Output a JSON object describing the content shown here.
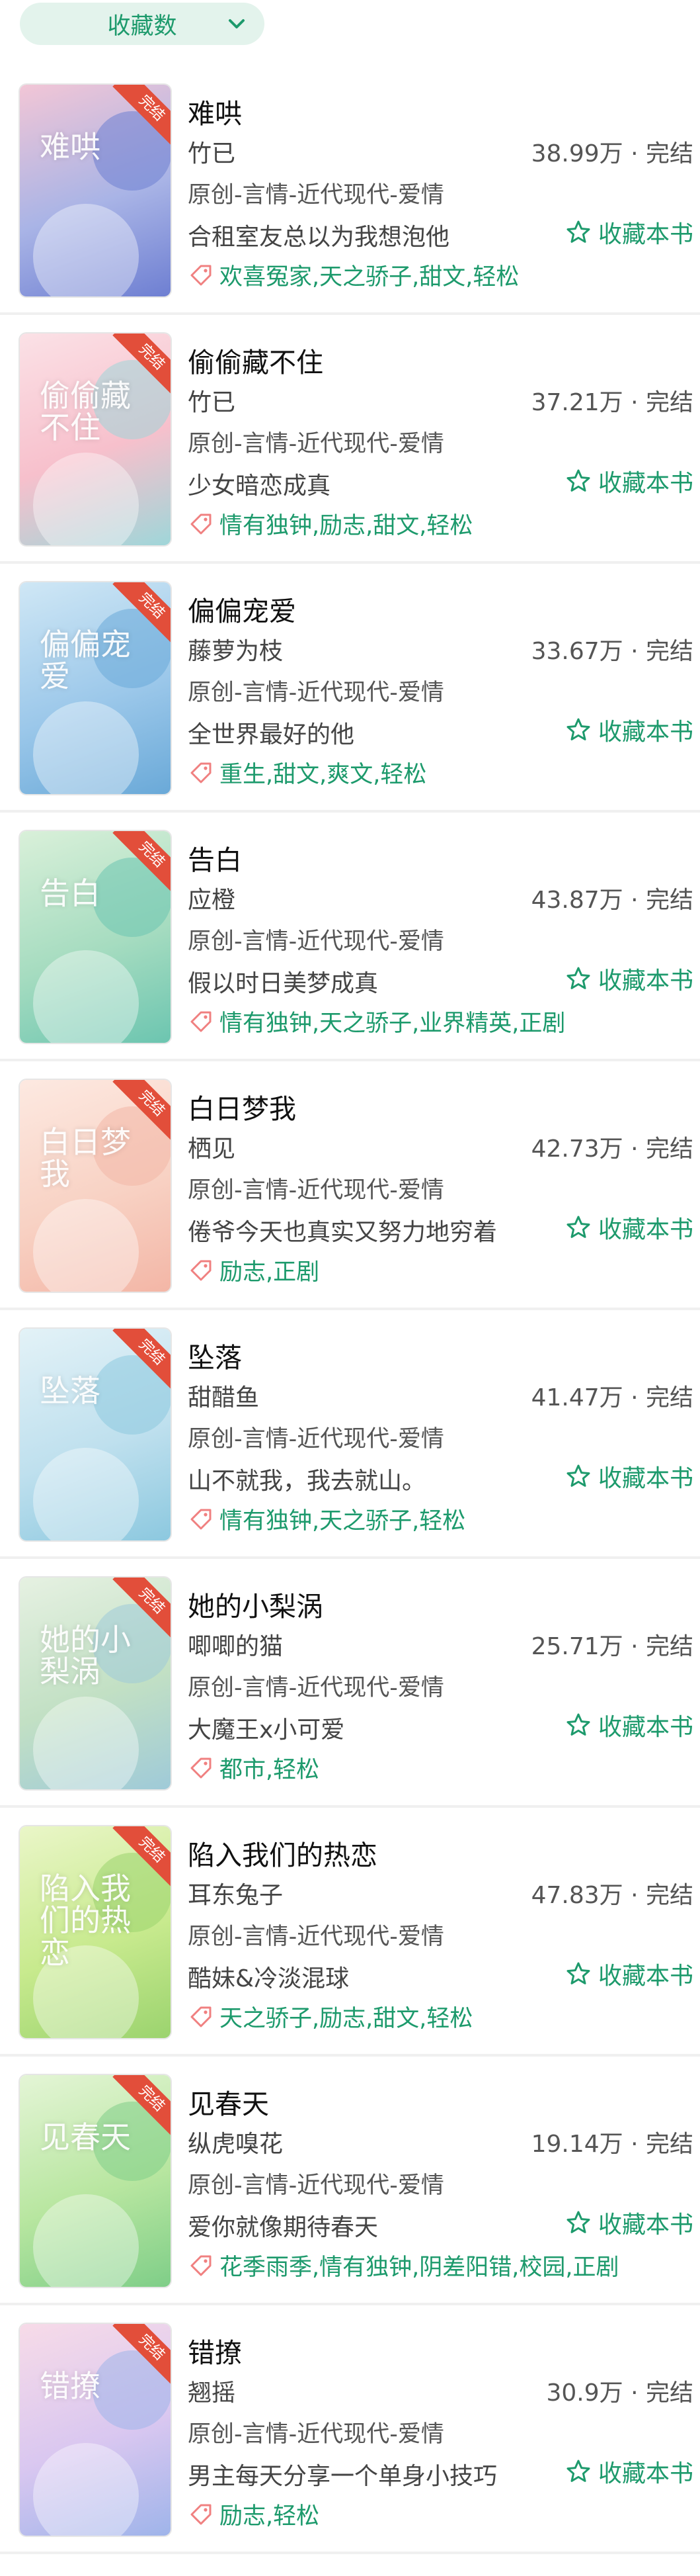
{
  "sort": {
    "label": "收藏数"
  },
  "collect_label": "收藏本书",
  "ribbon_text": "完结",
  "books": [
    {
      "title": "难哄",
      "author": "竹已",
      "stats": "38.99万 · 完结",
      "genre": "原创-言情-近代现代-爱情",
      "desc": "合租室友总以为我想泡他",
      "tags": "欢喜冤家,天之骄子,甜文,轻松",
      "cover_title": "难哄",
      "colors": [
        "#f2c6d6",
        "#a9b4e6",
        "#6e7fd2"
      ]
    },
    {
      "title": "偷偷藏不住",
      "author": "竹已",
      "stats": "37.21万 · 完结",
      "genre": "原创-言情-近代现代-爱情",
      "desc": "少女暗恋成真",
      "tags": "情有独钟,励志,甜文,轻松",
      "cover_title": "偷偷藏不住",
      "colors": [
        "#fbe1e6",
        "#f7c0cc",
        "#9fd6d9"
      ]
    },
    {
      "title": "偏偏宠爱",
      "author": "藤萝为枝",
      "stats": "33.67万 · 完结",
      "genre": "原创-言情-近代现代-爱情",
      "desc": "全世界最好的他",
      "tags": "重生,甜文,爽文,轻松",
      "cover_title": "偏偏宠爱",
      "colors": [
        "#cfe7f5",
        "#9cc8ea",
        "#6aa9d8"
      ]
    },
    {
      "title": "告白",
      "author": "应橙",
      "stats": "43.87万 · 完结",
      "genre": "原创-言情-近代现代-爱情",
      "desc": "假以时日美梦成真",
      "tags": "情有独钟,天之骄子,业界精英,正剧",
      "cover_title": "告白",
      "colors": [
        "#d9f0d9",
        "#a6dcc0",
        "#6cc5b0"
      ]
    },
    {
      "title": "白日梦我",
      "author": "栖见",
      "stats": "42.73万 · 完结",
      "genre": "原创-言情-近代现代-爱情",
      "desc": "倦爷今天也真实又努力地穷着",
      "tags": "励志,正剧",
      "cover_title": "白日梦我",
      "colors": [
        "#fde9e1",
        "#f8d2c4",
        "#f3b6a6"
      ]
    },
    {
      "title": "坠落",
      "author": "甜醋鱼",
      "stats": "41.47万 · 完结",
      "genre": "原创-言情-近代现代-爱情",
      "desc": "山不就我，我去就山。",
      "tags": "情有独钟,天之骄子,轻松",
      "cover_title": "坠落",
      "colors": [
        "#e3f2f7",
        "#bfe0ee",
        "#8cc8df"
      ]
    },
    {
      "title": "她的小梨涡",
      "author": "唧唧的猫",
      "stats": "25.71万 · 完结",
      "genre": "原创-言情-近代现代-爱情",
      "desc": "大魔王x小可爱",
      "tags": "都市,轻松",
      "cover_title": "她的小梨涡",
      "colors": [
        "#e6f1e2",
        "#c2e0c4",
        "#9fcad8"
      ]
    },
    {
      "title": "陷入我们的热恋",
      "author": "耳东兔子",
      "stats": "47.83万 · 完结",
      "genre": "原创-言情-近代现代-爱情",
      "desc": "酷妹&冷淡混球",
      "tags": "天之骄子,励志,甜文,轻松",
      "cover_title": "陷入我们的热恋",
      "colors": [
        "#eaf6c8",
        "#c8ea8e",
        "#9bd36e"
      ]
    },
    {
      "title": "见春天",
      "author": "纵虎嗅花",
      "stats": "19.14万 · 完结",
      "genre": "原创-言情-近代现代-爱情",
      "desc": "爱你就像期待春天",
      "tags": "花季雨季,情有独钟,阴差阳错,校园,正剧",
      "cover_title": "见春天",
      "colors": [
        "#e4f5d6",
        "#b8e6a0",
        "#7fce88"
      ]
    },
    {
      "title": "错撩",
      "author": "翘摇",
      "stats": "30.9万 · 完结",
      "genre": "原创-言情-近代现代-爱情",
      "desc": "男主每天分享一个单身小技巧",
      "tags": "励志,轻松",
      "cover_title": "错撩",
      "colors": [
        "#f7dbe8",
        "#d9c7f0",
        "#9fb4ea"
      ]
    }
  ],
  "colors": {
    "accent": "#1d9a6c",
    "chip_bg": "#e3f3ec",
    "ribbon": "#e24e3a"
  }
}
